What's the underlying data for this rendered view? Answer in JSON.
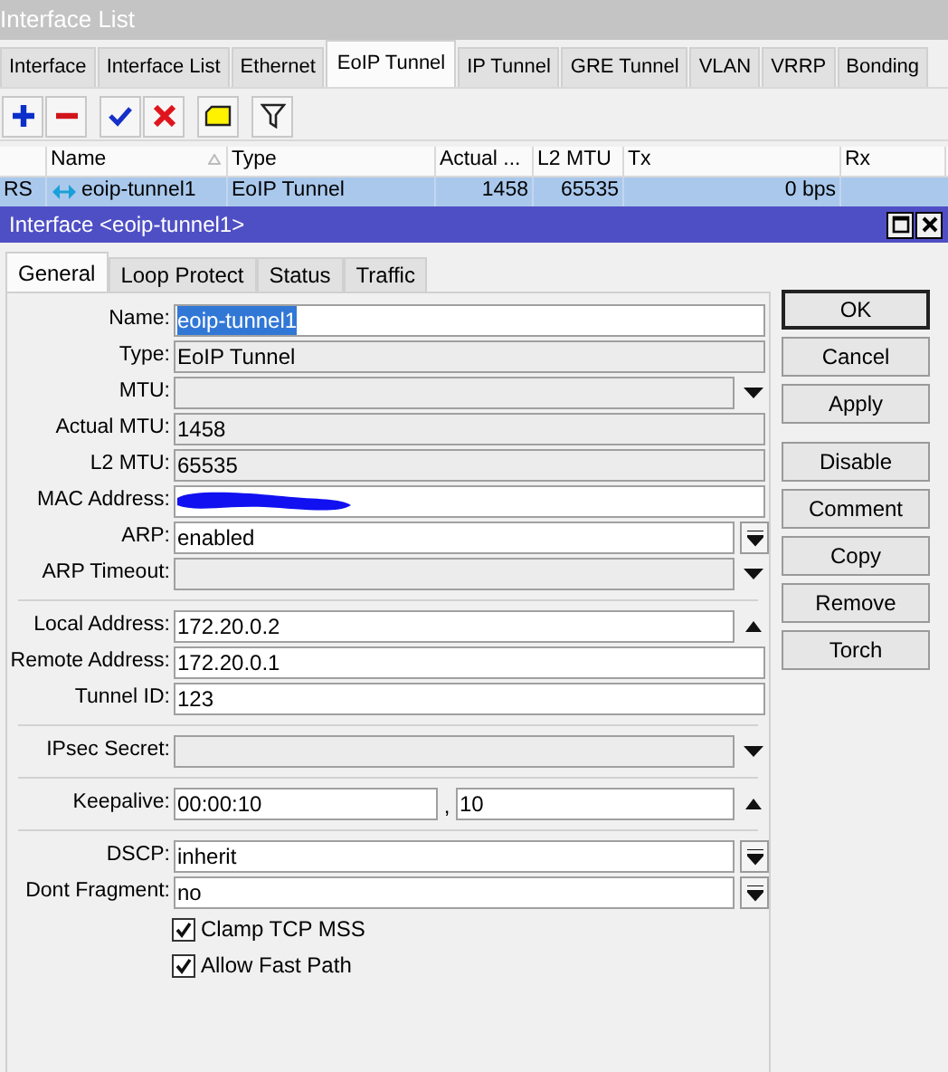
{
  "window": {
    "title": "Interface List"
  },
  "tabs": [
    {
      "label": "Interface",
      "selected": false
    },
    {
      "label": "Interface List",
      "selected": false
    },
    {
      "label": "Ethernet",
      "selected": false
    },
    {
      "label": "EoIP Tunnel",
      "selected": true
    },
    {
      "label": "IP Tunnel",
      "selected": false
    },
    {
      "label": "GRE Tunnel",
      "selected": false
    },
    {
      "label": "VLAN",
      "selected": false
    },
    {
      "label": "VRRP",
      "selected": false
    },
    {
      "label": "Bonding",
      "selected": false
    }
  ],
  "toolbar": [
    {
      "kind": "add"
    },
    {
      "kind": "remove"
    },
    {
      "kind": "enable"
    },
    {
      "kind": "disable"
    },
    {
      "kind": "comment"
    },
    {
      "kind": "filter"
    }
  ],
  "table": {
    "columns": [
      {
        "label": "Name",
        "sorted": true
      },
      {
        "label": "Type"
      },
      {
        "label": "Actual ..."
      },
      {
        "label": "L2 MTU"
      },
      {
        "label": "Tx"
      },
      {
        "label": "Rx"
      }
    ],
    "rows": [
      {
        "selected": true,
        "flags": "RS",
        "cells": [
          "eoip-tunnel1",
          "EoIP Tunnel",
          "1458",
          "65535",
          "0 bps"
        ]
      }
    ]
  },
  "dialog": {
    "title": "Interface <eoip-tunnel1>",
    "tabs": [
      {
        "label": "General",
        "selected": true
      },
      {
        "label": "Loop Protect",
        "selected": false
      },
      {
        "label": "Status",
        "selected": false
      },
      {
        "label": "Traffic",
        "selected": false
      }
    ],
    "rows": [
      {
        "kind": "field",
        "label": "Name:",
        "value": "eoip-tunnel1",
        "editable": true,
        "value_selected": true
      },
      {
        "kind": "field",
        "label": "Type:",
        "value": "EoIP Tunnel",
        "editable": false
      },
      {
        "kind": "field",
        "label": "MTU:",
        "editable": false,
        "control": {
          "kind": "down"
        }
      },
      {
        "kind": "field",
        "label": "Actual MTU:",
        "value": "1458",
        "editable": false
      },
      {
        "kind": "field",
        "label": "L2 MTU:",
        "value": "65535",
        "editable": false
      },
      {
        "kind": "field",
        "label": "MAC Address:",
        "editable": true,
        "redacted": true
      },
      {
        "kind": "field",
        "label": "ARP:",
        "value": "enabled",
        "editable": true,
        "control": {
          "kind": "select"
        }
      },
      {
        "kind": "field",
        "label": "ARP Timeout:",
        "editable": false,
        "control": {
          "kind": "down"
        }
      },
      {
        "kind": "separator"
      },
      {
        "kind": "field",
        "label": "Local Address:",
        "value": "172.20.0.2",
        "editable": true,
        "control": {
          "kind": "up"
        }
      },
      {
        "kind": "field",
        "label": "Remote Address:",
        "value": "172.20.0.1",
        "editable": true
      },
      {
        "kind": "field",
        "label": "Tunnel ID:",
        "value": "123",
        "editable": true
      },
      {
        "kind": "separator"
      },
      {
        "kind": "field",
        "label": "IPsec Secret:",
        "editable": false,
        "control": {
          "kind": "down"
        }
      },
      {
        "kind": "separator"
      },
      {
        "kind": "pair",
        "label": "Keepalive:",
        "value": "00:00:10",
        "joiner": ",",
        "value2": "10",
        "control": {
          "kind": "up"
        }
      },
      {
        "kind": "separator"
      },
      {
        "kind": "field",
        "label": "DSCP:",
        "value": "inherit",
        "editable": true,
        "control": {
          "kind": "select"
        }
      },
      {
        "kind": "field",
        "label": "Dont Fragment:",
        "value": "no",
        "editable": true,
        "control": {
          "kind": "select"
        }
      },
      {
        "kind": "checkbox",
        "label": "Clamp TCP MSS",
        "checked": true
      },
      {
        "kind": "checkbox",
        "label": "Allow Fast Path",
        "checked": true
      }
    ],
    "button_groups": [
      {
        "buttons": [
          {
            "label": "OK",
            "default": true
          },
          {
            "label": "Cancel",
            "default": false
          },
          {
            "label": "Apply",
            "default": false
          }
        ]
      },
      {
        "buttons": [
          {
            "label": "Disable",
            "default": false
          },
          {
            "label": "Comment",
            "default": false
          },
          {
            "label": "Copy",
            "default": false
          },
          {
            "label": "Remove",
            "default": false
          },
          {
            "label": "Torch",
            "default": false
          }
        ]
      }
    ]
  }
}
